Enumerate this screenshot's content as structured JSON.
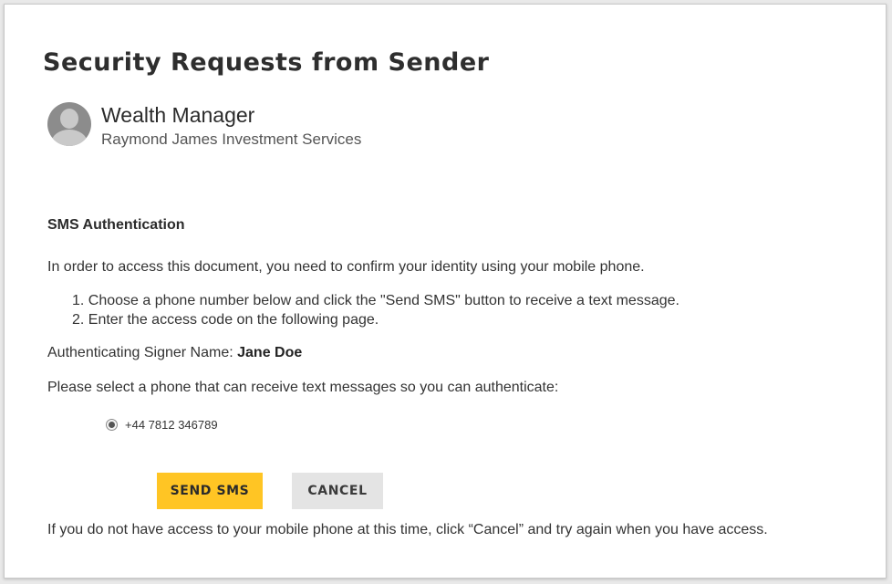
{
  "dialog": {
    "title": "Security Requests from Sender"
  },
  "sender": {
    "name": "Wealth Manager",
    "company": "Raymond James Investment Services",
    "avatar_icon": "user-avatar-icon"
  },
  "sms": {
    "heading": "SMS Authentication",
    "intro": "In order to access this document, you need to confirm your identity using your mobile phone.",
    "steps": [
      "1. Choose a phone number below and click the \"Send SMS\" button to receive a text message.",
      "2. Enter the access code on the following page."
    ],
    "signer_label": "Authenticating Signer Name: ",
    "signer_name": "Jane Doe",
    "select_prompt": "Please select a phone that can receive text messages so you can authenticate:",
    "phone_options": [
      {
        "number": "+44 7812 346789",
        "selected": true
      }
    ],
    "send_label": "SEND SMS",
    "cancel_label": "CANCEL",
    "footer": "If you do not have access to your mobile phone at this time, click “Cancel” and try again when you have access."
  },
  "colors": {
    "accent": "#ffc524",
    "cancel_bg": "#e4e4e4",
    "text": "#333333"
  }
}
